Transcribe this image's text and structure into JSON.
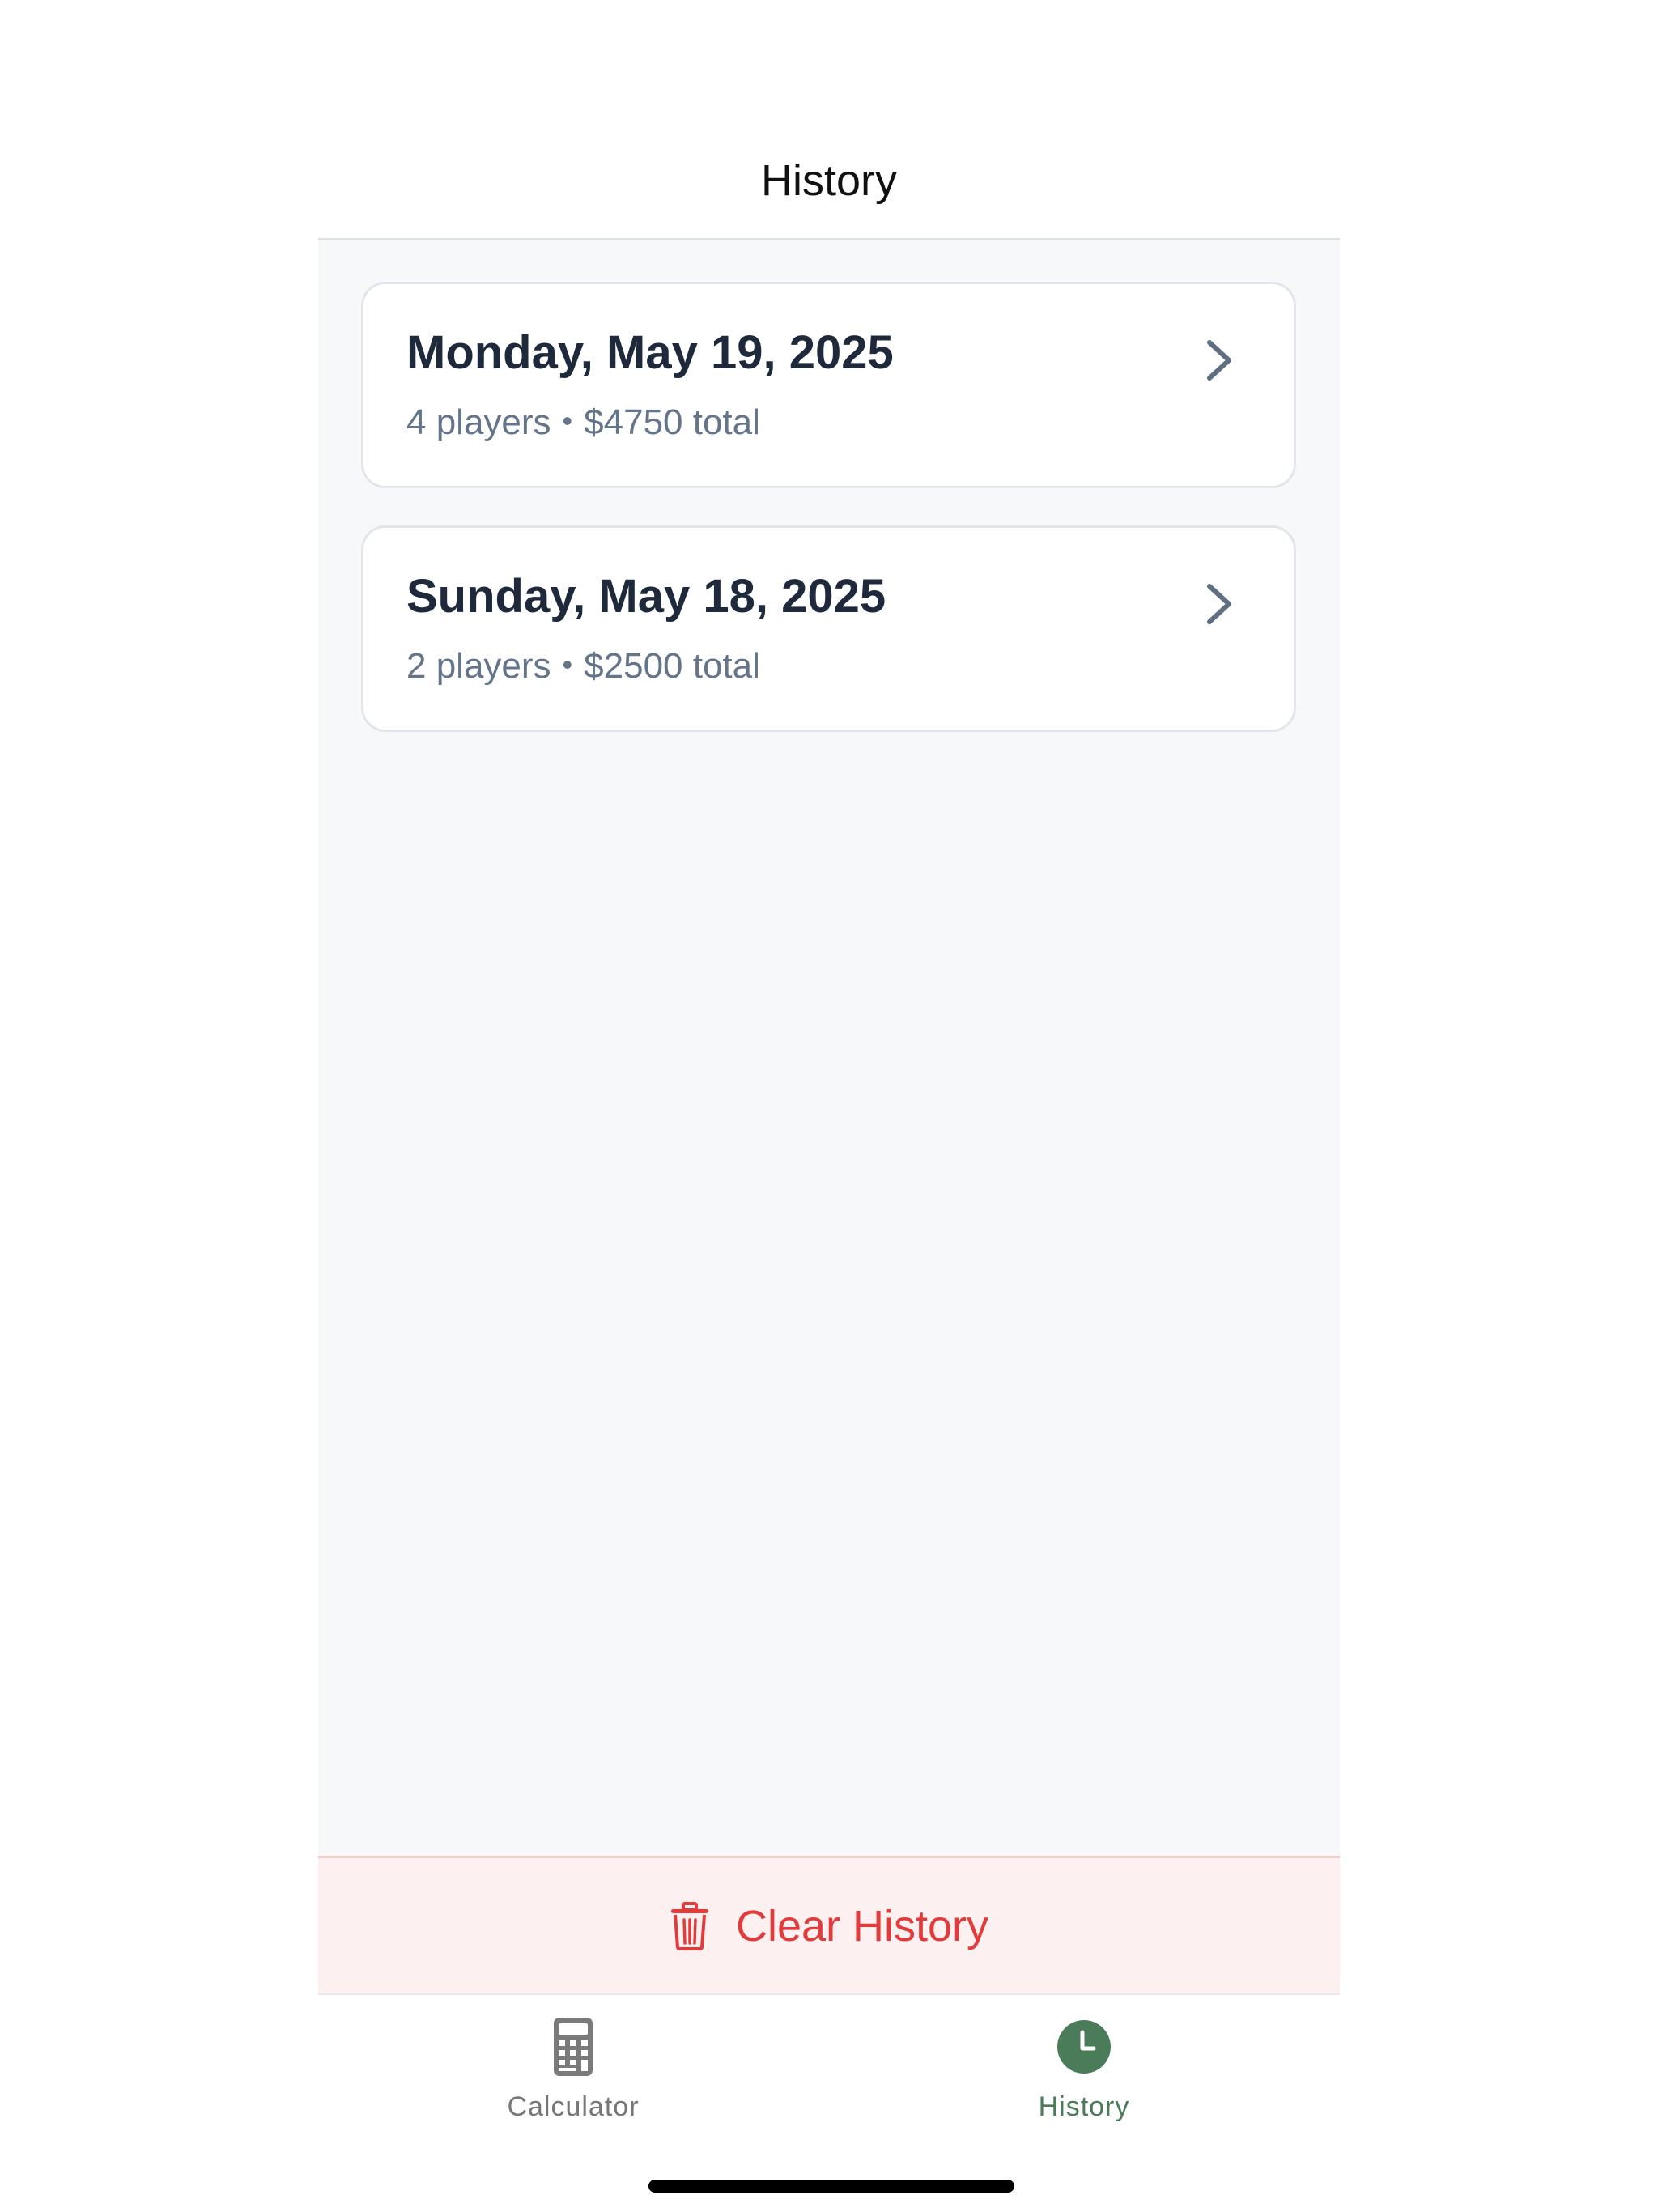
{
  "header": {
    "title": "History"
  },
  "sessions": [
    {
      "date": "Monday, May 19, 2025",
      "players": "4 players",
      "separator": "•",
      "total": "$4750 total"
    },
    {
      "date": "Sunday, May 18, 2025",
      "players": "2 players",
      "separator": "•",
      "total": "$2500 total"
    }
  ],
  "clear_history": {
    "label": "Clear History",
    "icon": "trash-icon",
    "color": "#e23b3b"
  },
  "tabbar": {
    "tabs": [
      {
        "label": "Calculator",
        "icon": "calculator-icon",
        "active": false,
        "color": "#777777"
      },
      {
        "label": "History",
        "icon": "clock-icon",
        "active": true,
        "color": "#4a7c59"
      }
    ]
  }
}
